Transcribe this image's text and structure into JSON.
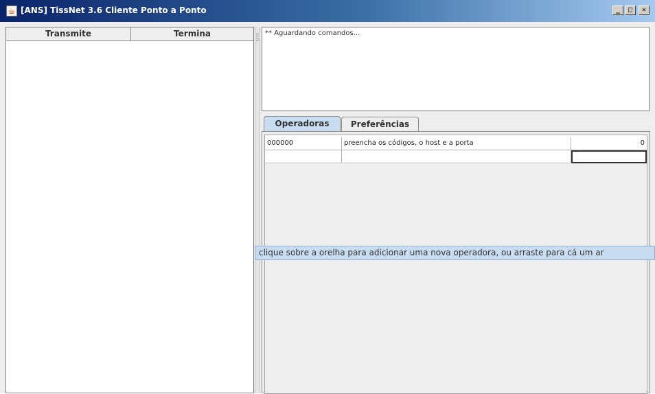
{
  "window": {
    "title": "[ANS] TissNet 3.6 Cliente Ponto a Ponto",
    "icon": "java-cup-icon",
    "controls": {
      "minimize": "_",
      "maximize": "□",
      "close": "✕"
    }
  },
  "left_table": {
    "columns": [
      "Transmite",
      "Termina"
    ]
  },
  "log": {
    "text": "** Aguardando comandos..."
  },
  "tabs": [
    {
      "label": "Operadoras",
      "active": true
    },
    {
      "label": "Preferências",
      "active": false
    }
  ],
  "operadoras_table": {
    "rows": [
      [
        "000000",
        "preencha os códigos, o host e a porta",
        "0"
      ],
      [
        "",
        "",
        ""
      ]
    ]
  },
  "tooltip": {
    "text": "clique sobre a orelha para adicionar uma nova operadora, ou arraste para cá um ar"
  },
  "colors": {
    "title_gradient_start": "#0a246a",
    "title_gradient_end": "#a6caf0",
    "active_tab": "#c8ddf2",
    "tooltip_bg": "#c8ddf2",
    "panel_bg": "#eeeeee"
  }
}
